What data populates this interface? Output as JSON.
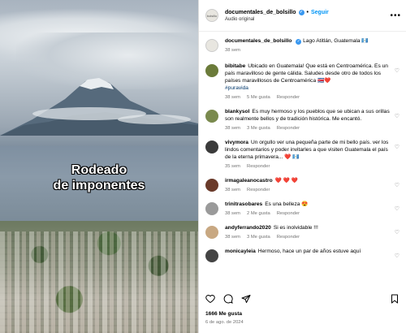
{
  "media": {
    "caption_line1": "Rodeado",
    "caption_line2": "de imponentes"
  },
  "header": {
    "username": "documentales_de_bolsillo",
    "follow_label": "Seguir",
    "audio_label": "Audio original",
    "avatar_text": "bolsillo"
  },
  "post": {
    "username": "documentales_de_bolsillo",
    "location": "Lago Atitlán, Guatemala 🇬🇹",
    "time": "38 sem"
  },
  "comments": [
    {
      "user": "bibitabe",
      "text": "Ubicado en Guatemala! Que está en Centroamérica. Es un país maravilloso de gente cálida. Saludes desde otro de todos los países maravillosos de Centroamérica 🇨🇷❤️",
      "hashtag": "#puravida",
      "time": "38 sem",
      "likes": "5 Me gusta",
      "reply": "Responder",
      "avatar_color": "#6b7b3a"
    },
    {
      "user": "blankysol",
      "text": "Es muy hermoso y los pueblos que se ubican a sus orillas son realmente bellos y de tradición histórica. Me encantó.",
      "hashtag": "",
      "time": "38 sem",
      "likes": "3 Me gusta",
      "reply": "Responder",
      "avatar_color": "#7a8a4e"
    },
    {
      "user": "vivymora",
      "text": "Un orgullo ver una pequeña parte de mi bello país. ver los lindos comentarios y poder invitarles a que visiten Guatemala el país de la eterna primavera... ❤️ 🇬🇹",
      "hashtag": "",
      "time": "35 sem",
      "likes": "",
      "reply": "Responder",
      "avatar_color": "#3b3b3b"
    },
    {
      "user": "irmagaleanocastro",
      "text": "❤️ ❤️ ❤️",
      "hashtag": "",
      "time": "38 sem",
      "likes": "",
      "reply": "Responder",
      "avatar_color": "#6a3a2a"
    },
    {
      "user": "trinitrasobares",
      "text": "Es una belleza 😍",
      "hashtag": "",
      "time": "38 sem",
      "likes": "2 Me gusta",
      "reply": "Responder",
      "avatar_color": "#9a9a9a"
    },
    {
      "user": "andyferrando2020",
      "text": "Si es inolvidable !!!",
      "hashtag": "",
      "time": "38 sem",
      "likes": "3 Me gusta",
      "reply": "Responder",
      "avatar_color": "#c8a882"
    },
    {
      "user": "monicayleia",
      "text": "Hermoso, hace un par de años estuve aquí",
      "hashtag": "",
      "time": "",
      "likes": "",
      "reply": "",
      "avatar_color": "#444444"
    }
  ],
  "footer": {
    "likes": "1666 Me gusta",
    "date": "6 de ago. de 2024"
  },
  "icons": {
    "like": "heart-icon",
    "comment": "comment-icon",
    "share": "share-icon",
    "save": "bookmark-icon",
    "more": "more-icon",
    "verified": "verified-badge-icon"
  },
  "colors": {
    "link_blue": "#0095f6",
    "verified_blue": "#3897f0",
    "muted": "#737373"
  }
}
